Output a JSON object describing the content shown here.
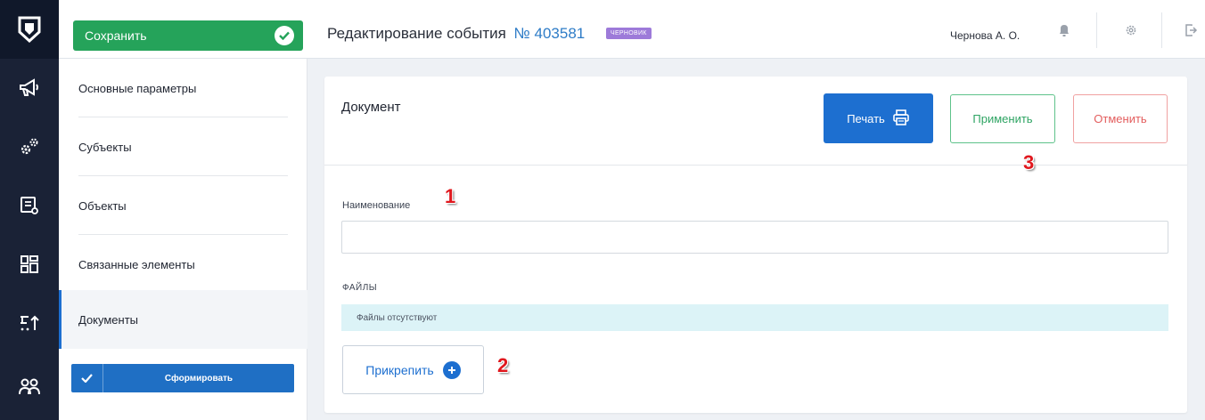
{
  "toolbar": {
    "save_label": "Сохранить"
  },
  "header": {
    "title": "Редактирование события",
    "number": "№ 403581",
    "status_badge": "ЧЕРНОВИК",
    "user_name": "Чернова А. О."
  },
  "sidebar": {
    "items": [
      {
        "label": "Основные параметры"
      },
      {
        "label": "Субъекты"
      },
      {
        "label": "Объекты"
      },
      {
        "label": "Связанные элементы"
      },
      {
        "label": "Документы"
      }
    ],
    "active_item": "Документы",
    "form_button_label": "Сформировать"
  },
  "document": {
    "title": "Документ",
    "print_label": "Печать",
    "apply_label": "Применить",
    "cancel_label": "Отменить",
    "name_label": "Наименование",
    "name_value": "",
    "files_label": "ФАЙЛЫ",
    "files_empty_text": "Файлы отсутствуют",
    "attach_label": "Прикрепить"
  },
  "annotations": {
    "one": "1",
    "two": "2",
    "three": "3"
  },
  "icons": {
    "rail": [
      "logo-shield-icon",
      "megaphone-icon",
      "gears-icon",
      "report-icon",
      "dashboard-grid-icon",
      "sort-icon",
      "users-icon"
    ],
    "top": [
      "bell-icon",
      "settings-gear-icon",
      "logout-icon"
    ],
    "print": "printer-icon",
    "attach": "plus-circle-icon"
  },
  "colors": {
    "save_green": "#25a35a",
    "primary_blue": "#1d6fd0",
    "apply_green": "#2ea463",
    "cancel_red": "#e35d5d",
    "draft_purple": "#9d7ad9",
    "rail_dark": "#10182a",
    "files_bg": "#dcf3f7",
    "annotation_red": "#e0181e"
  }
}
